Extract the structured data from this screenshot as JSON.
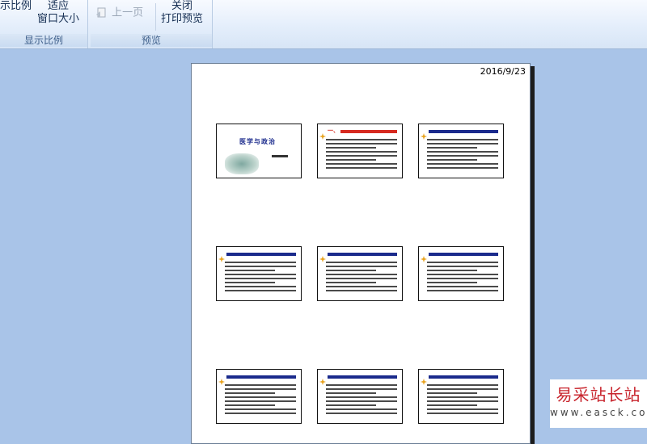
{
  "ribbon": {
    "zoom_group": {
      "label": "显示比例",
      "zoom_button": "示比例",
      "fit_button_line1": "适应",
      "fit_button_line2": "窗口大小"
    },
    "preview_group": {
      "label": "预览",
      "prev_page_button": "上一页",
      "close_button_line1": "关闭",
      "close_button_line2": "打印预览"
    }
  },
  "page": {
    "date": "2016/9/23",
    "slides": [
      {
        "id": 1,
        "title": "医学与政治",
        "title_color": "#1a2a8c",
        "has_image": true
      },
      {
        "id": 2,
        "title": "一、",
        "title_color": "#d62a1f"
      },
      {
        "id": 3,
        "title": "",
        "title_color": "#1a2a8c"
      },
      {
        "id": 4,
        "title": "",
        "title_color": "#1a2a8c"
      },
      {
        "id": 5,
        "title": "",
        "title_color": "#1a2a8c"
      },
      {
        "id": 6,
        "title": "",
        "title_color": "#1a2a8c"
      },
      {
        "id": 7,
        "title": "",
        "title_color": "#1a2a8c"
      },
      {
        "id": 8,
        "title": "",
        "title_color": "#1a2a8c"
      },
      {
        "id": 9,
        "title": "",
        "title_color": "#1a2a8c"
      }
    ]
  },
  "watermark": {
    "main": "易采站长站",
    "sub": "www.easck.com",
    "color": "#c8242c"
  }
}
